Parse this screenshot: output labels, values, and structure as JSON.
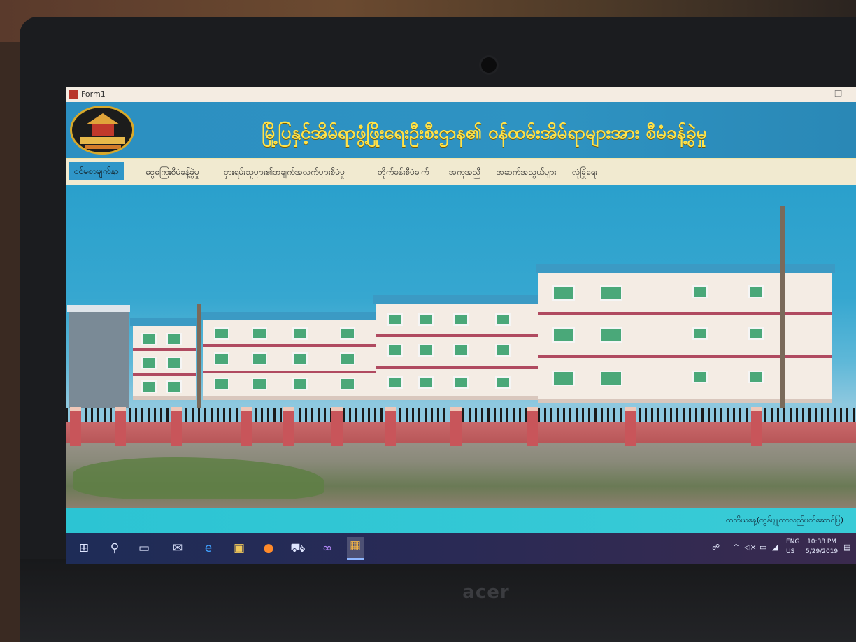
{
  "window": {
    "title": "Form1"
  },
  "header": {
    "title": "မြို့ပြနှင့်အိမ်ရာဖွံ့ဖြိုးရေးဦးစီးဌာန၏ ဝန်ထမ်းအိမ်ရာများအား စီမံခန့်ခွဲမှု"
  },
  "menu": {
    "items": [
      {
        "label": "ဝင်မစာမျက်နှာ"
      },
      {
        "label": "ငွေကြေးစီမံခန့်ခွဲမှု"
      },
      {
        "label": "ငှားရမ်းသူများ၏အချက်အလက်များစီမံမှု"
      },
      {
        "label": "တိုက်ခန်းစီမံချက်"
      },
      {
        "label": "အကူအညီ"
      },
      {
        "label": "အဆက်အသွယ်များ"
      },
      {
        "label": "လုံခြုံရေး"
      }
    ],
    "active_index": 0
  },
  "status": {
    "text": "ထတိယနေ့(ကွန်ပျူတာလည်ပတ်ဆောင်ပြ)"
  },
  "taskbar": {
    "icons": [
      "windows-start-icon",
      "search-icon",
      "task-view-icon",
      "mail-icon",
      "edge-icon",
      "file-explorer-icon",
      "firefox-icon",
      "store-icon",
      "visual-studio-icon",
      "form-app-icon"
    ],
    "lang_top": "ENG",
    "lang_bottom": "US",
    "time": "10:38 PM",
    "date": "5/29/2019"
  },
  "photo": {
    "brand": "acer"
  },
  "colors": {
    "header_bg": "#2c8fc1",
    "title_text": "#ffe34a",
    "menu_bg": "#f1ead0",
    "menu_active": "#2f96c8",
    "status_bg": "#2cc4d3"
  }
}
